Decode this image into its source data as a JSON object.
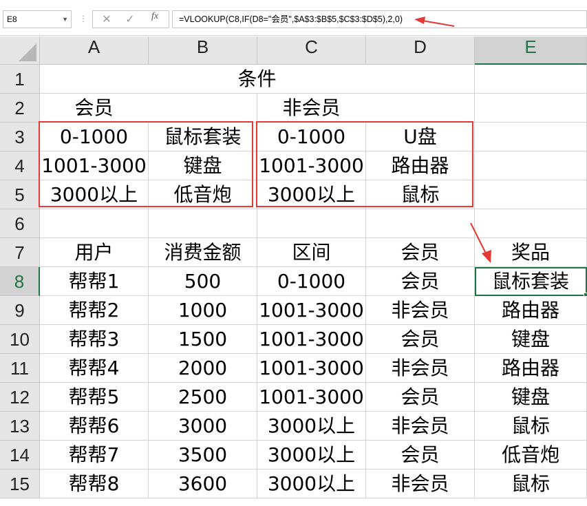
{
  "name_box": "E8",
  "formula_bar": {
    "cancel_icon": "close-icon",
    "enter_icon": "check-icon",
    "fx_label": "fx",
    "formula": "=VLOOKUP(C8,IF(D8=\"会员\",$A$3:$B$5,$C$3:$D$5),2,0)"
  },
  "columns": [
    "A",
    "B",
    "C",
    "D",
    "E"
  ],
  "rows": [
    "1",
    "2",
    "3",
    "4",
    "5",
    "6",
    "7",
    "8",
    "9",
    "10",
    "11",
    "12",
    "13",
    "14",
    "15"
  ],
  "selected_cell": {
    "col": "E",
    "row": "8"
  },
  "cells": {
    "r1": {
      "merged_A_D": "条件",
      "E": ""
    },
    "r2": {
      "A": "会员",
      "B": "",
      "C": "非会员",
      "D": "",
      "E": ""
    },
    "r3": {
      "A": "0-1000",
      "B": "鼠标套装",
      "C": "0-1000",
      "D": "U盘",
      "E": ""
    },
    "r4": {
      "A": "1001-3000",
      "B": "键盘",
      "C": "1001-3000",
      "D": "路由器",
      "E": ""
    },
    "r5": {
      "A": "3000以上",
      "B": "低音炮",
      "C": "3000以上",
      "D": "鼠标",
      "E": ""
    },
    "r6": {
      "A": "",
      "B": "",
      "C": "",
      "D": "",
      "E": ""
    },
    "r7": {
      "A": "用户",
      "B": "消费金额",
      "C": "区间",
      "D": "会员",
      "E": "奖品"
    },
    "r8": {
      "A": "帮帮1",
      "B": "500",
      "C": "0-1000",
      "D": "会员",
      "E": "鼠标套装"
    },
    "r9": {
      "A": "帮帮2",
      "B": "1000",
      "C": "1001-3000",
      "D": "非会员",
      "E": "路由器"
    },
    "r10": {
      "A": "帮帮3",
      "B": "1500",
      "C": "1001-3000",
      "D": "会员",
      "E": "键盘"
    },
    "r11": {
      "A": "帮帮4",
      "B": "2000",
      "C": "1001-3000",
      "D": "非会员",
      "E": "路由器"
    },
    "r12": {
      "A": "帮帮5",
      "B": "2500",
      "C": "1001-3000",
      "D": "会员",
      "E": "键盘"
    },
    "r13": {
      "A": "帮帮6",
      "B": "3000",
      "C": "3000以上",
      "D": "非会员",
      "E": "鼠标"
    },
    "r14": {
      "A": "帮帮7",
      "B": "3500",
      "C": "3000以上",
      "D": "会员",
      "E": "低音炮"
    },
    "r15": {
      "A": "帮帮8",
      "B": "3600",
      "C": "3000以上",
      "D": "非会员",
      "E": "鼠标"
    }
  },
  "colors": {
    "annotation_red": "#e53935",
    "selection_green": "#217346",
    "header_bg": "#e6e6e6"
  }
}
